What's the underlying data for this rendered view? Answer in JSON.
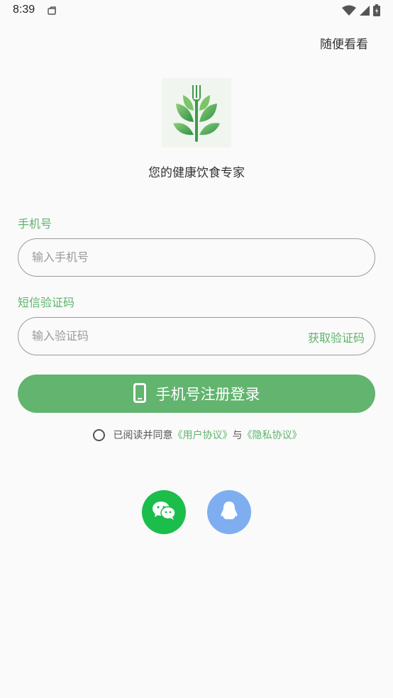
{
  "status_bar": {
    "time": "8:39"
  },
  "header": {
    "browse_label": "随便看看"
  },
  "brand": {
    "tagline": "您的健康饮食专家"
  },
  "phone_field": {
    "label": "手机号",
    "placeholder": "输入手机号",
    "value": ""
  },
  "code_field": {
    "label": "短信验证码",
    "placeholder": "输入验证码",
    "value": "",
    "get_code_label": "获取验证码"
  },
  "login_button": {
    "label": "手机号注册登录"
  },
  "agreement": {
    "prefix": "已阅读并同意",
    "user_agreement": "《用户协议》",
    "conjunction": "与",
    "privacy_policy": "《隐私协议》",
    "checked": false
  },
  "social_login": {
    "items": [
      {
        "name": "wechat",
        "icon": "wechat-icon",
        "color": "#1bbd4b"
      },
      {
        "name": "qq",
        "icon": "qq-icon",
        "color": "#7eaef0"
      }
    ]
  },
  "colors": {
    "accent": "#62b46e",
    "background": "#fafafa"
  }
}
